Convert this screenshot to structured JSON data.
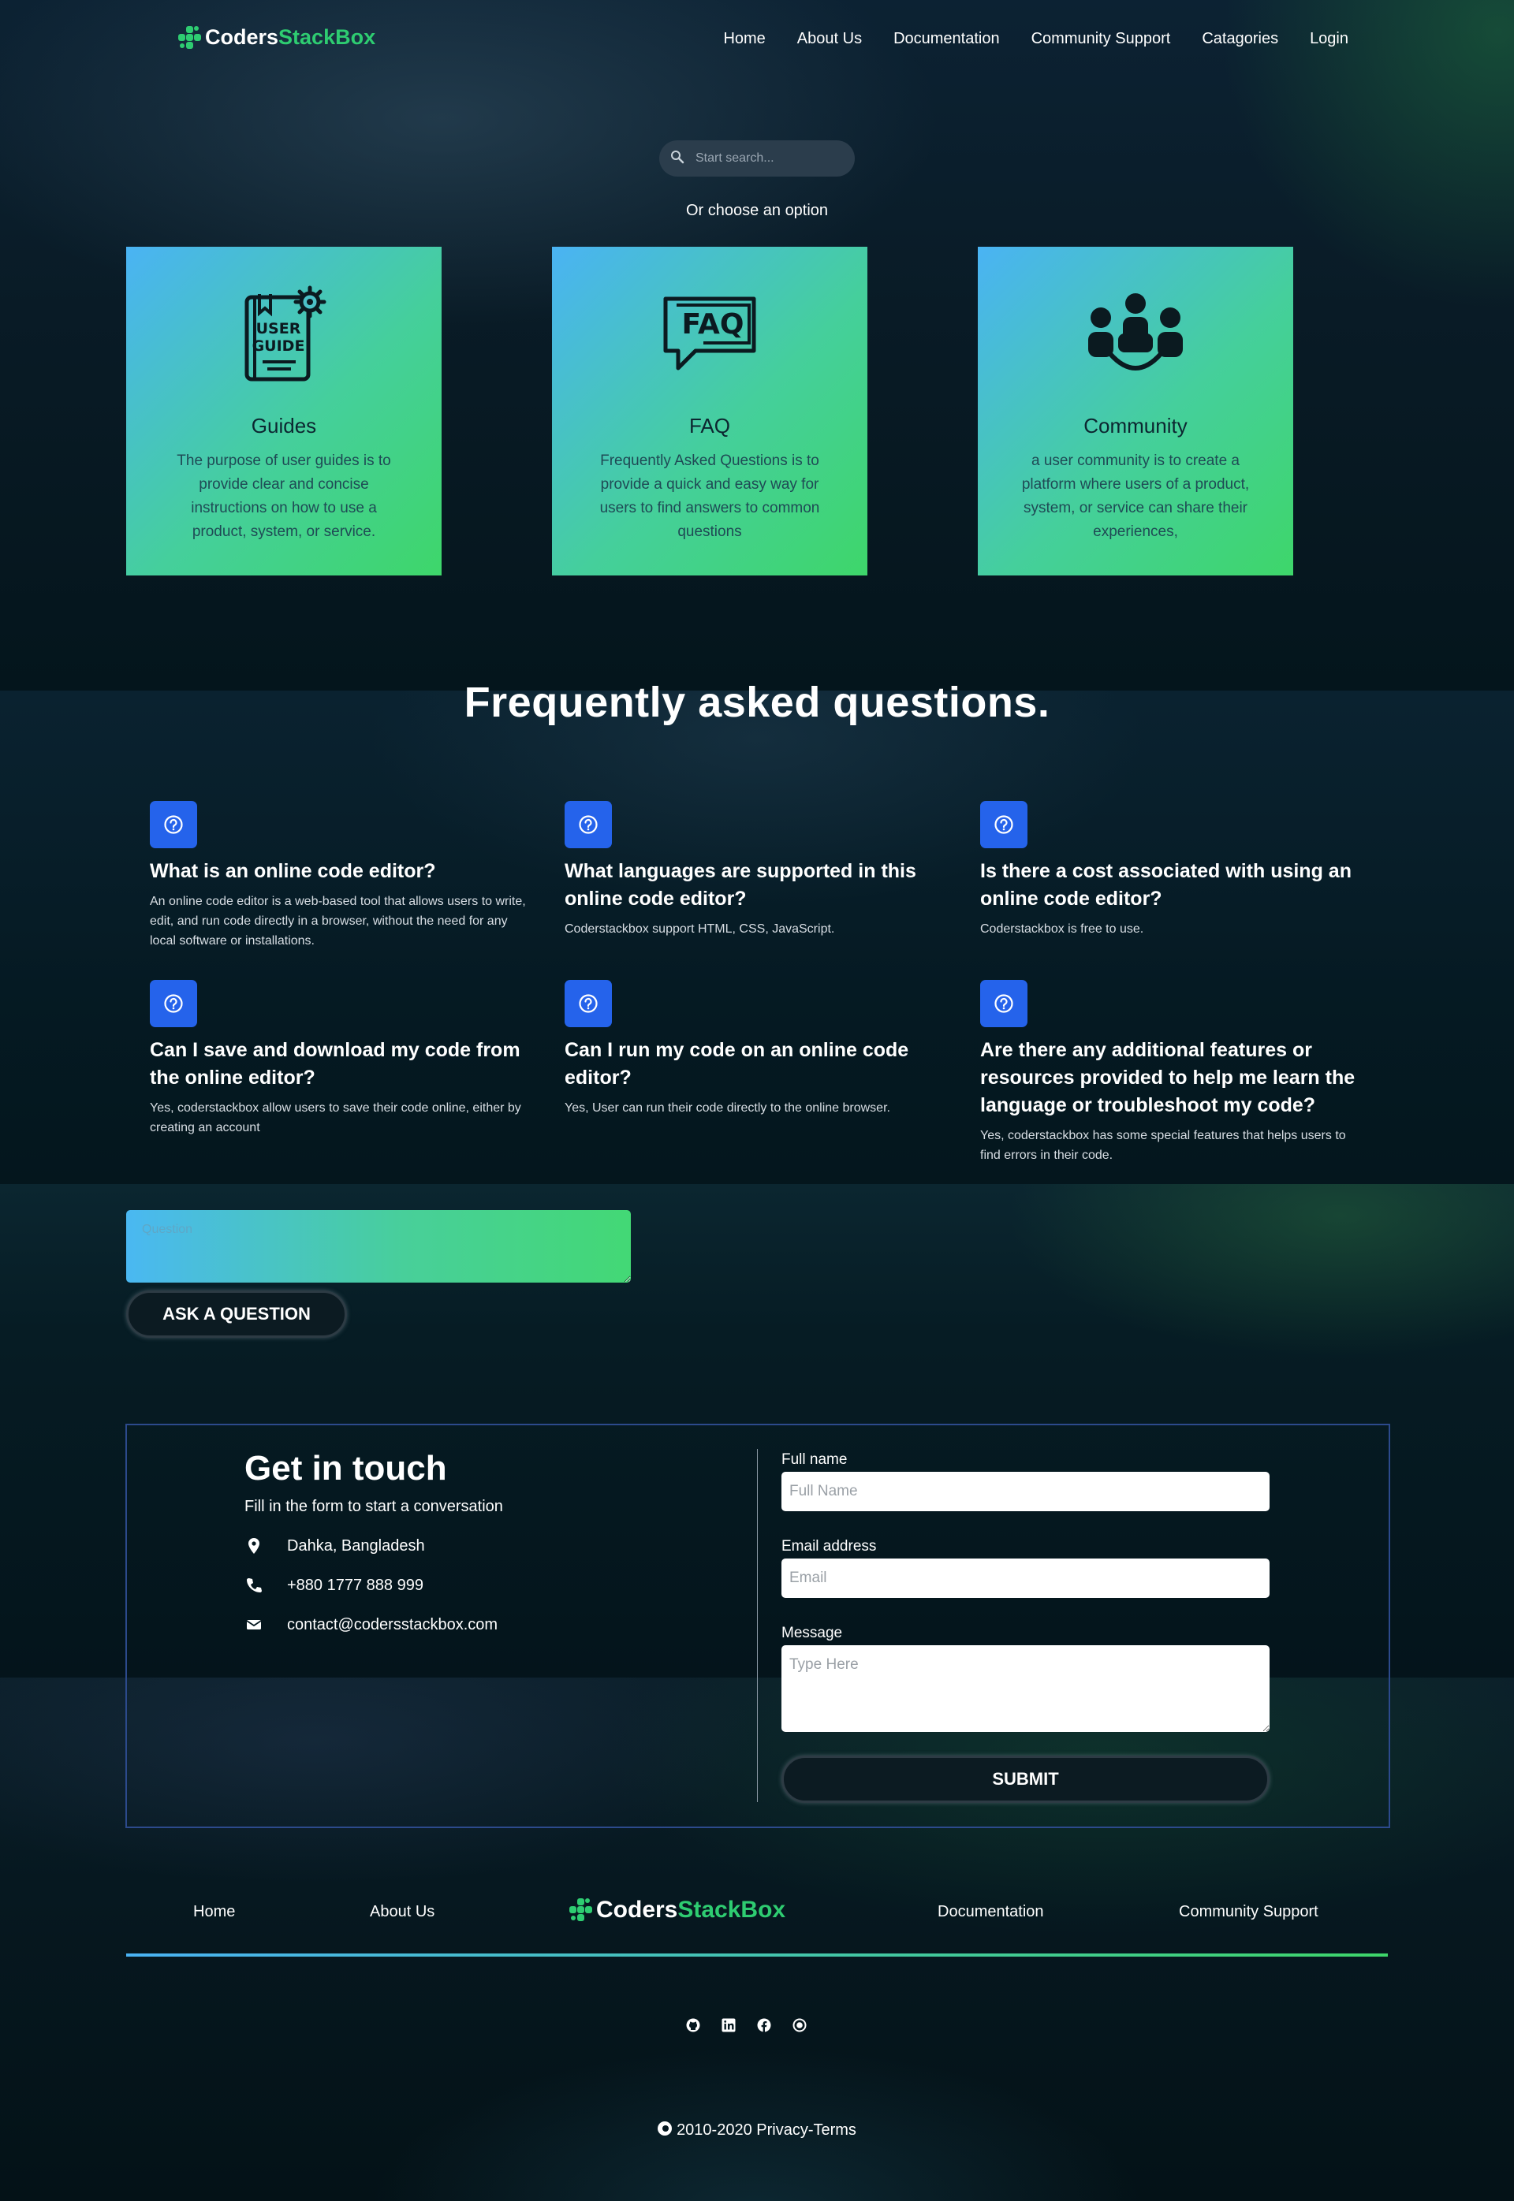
{
  "header": {
    "logo_part1": "Coders",
    "logo_part2": "StackBox",
    "nav": [
      "Home",
      "About Us",
      "Documentation",
      "Community Support",
      "Catagories",
      "Login"
    ]
  },
  "search": {
    "placeholder": "Start search..."
  },
  "choose_text": "Or choose an option",
  "options": [
    {
      "title": "Guides",
      "icon": "user-guide-icon",
      "icon_text_1": "USER",
      "icon_text_2": "GUIDE",
      "text": "The purpose of user guides is to provide clear and concise instructions on how to use a product, system, or service."
    },
    {
      "title": "FAQ",
      "icon": "faq-icon",
      "icon_text": "FAQ",
      "text": "Frequently Asked Questions is to provide a quick and easy way for users to find answers to common questions"
    },
    {
      "title": "Community",
      "icon": "community-icon",
      "text": "a user community is to create a platform where users of a product, system, or service can share their experiences,"
    }
  ],
  "faq": {
    "title": "Frequently asked questions.",
    "items": [
      {
        "q": "What is an online code editor?",
        "a": "An online code editor is a web-based tool that allows users to write, edit, and run code directly in a browser, without the need for any local software or installations."
      },
      {
        "q": "What languages are supported in this online code editor?",
        "a": "Coderstackbox support HTML, CSS, JavaScript."
      },
      {
        "q": "Is there a cost associated with using an online code editor?",
        "a": "Coderstackbox is free to use."
      },
      {
        "q": "Can I save and download my code from the online editor?",
        "a": "Yes, coderstackbox allow users to save their code online, either by creating an account"
      },
      {
        "q": "Can I run my code on an online code editor?",
        "a": "Yes, User can run their code directly to the online browser."
      },
      {
        "q": "Are there any additional features or resources provided to help me learn the language or troubleshoot my code?",
        "a": "Yes, coderstackbox has some special features that helps users to find errors in their code."
      }
    ]
  },
  "ask": {
    "placeholder": "Question",
    "button": "ASK A QUESTION"
  },
  "contact": {
    "title": "Get in touch",
    "subtitle": "Fill in the form to start a conversation",
    "address": "Dahka, Bangladesh",
    "phone": "+880 1777 888 999",
    "email": "contact@codersstackbox.com",
    "labels": {
      "name": "Full name",
      "email": "Email address",
      "message": "Message"
    },
    "placeholders": {
      "name": "Full Name",
      "email": "Email",
      "message": "Type Here"
    },
    "submit": "SUBMIT"
  },
  "footer": {
    "nav_left": [
      "Home",
      "About Us"
    ],
    "nav_right": [
      "Documentation",
      "Community Support"
    ],
    "logo_part1": "Coders",
    "logo_part2": "StackBox",
    "social": [
      "github-icon",
      "linkedin-icon",
      "facebook-icon",
      "radio-icon"
    ],
    "copyright": "2010-2020 Privacy-Terms"
  },
  "colors": {
    "accent_green": "#2ecc71",
    "accent_blue": "#4ab3f4",
    "faq_icon_bg": "#2563eb",
    "contact_border": "#2c4a8c"
  }
}
